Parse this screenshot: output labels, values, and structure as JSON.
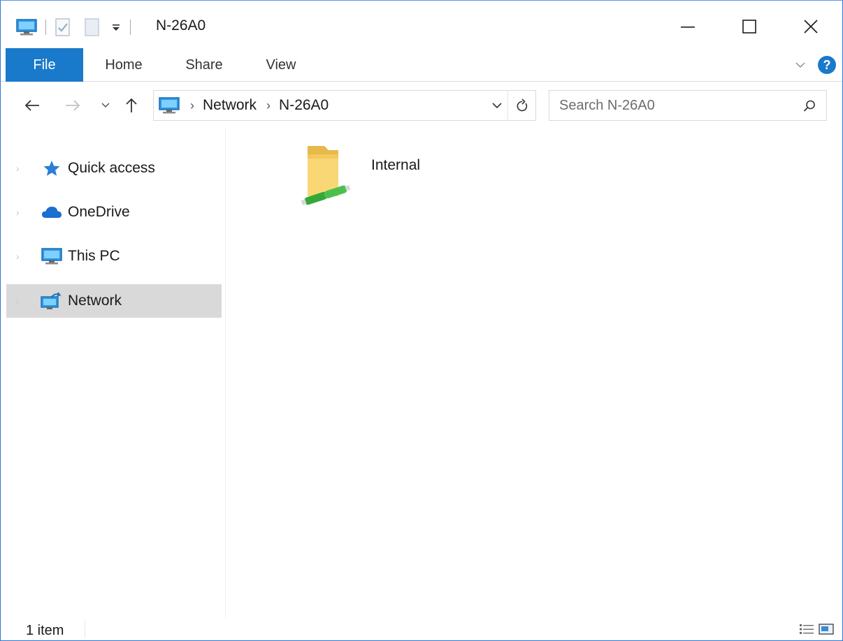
{
  "window": {
    "title": "N-26A0",
    "accent": "#1979ca"
  },
  "quick_access_toolbar": {
    "items": [
      "computer-icon",
      "properties-icon",
      "new-folder-icon",
      "customize-dropdown"
    ]
  },
  "ribbon": {
    "tabs": [
      {
        "label": "File",
        "active": true
      },
      {
        "label": "Home"
      },
      {
        "label": "Share"
      },
      {
        "label": "View"
      }
    ]
  },
  "address_bar": {
    "crumbs": [
      "Network",
      "N-26A0"
    ]
  },
  "search": {
    "placeholder": "Search N-26A0"
  },
  "nav_pane": {
    "items": [
      {
        "label": "Quick access",
        "icon": "star-icon"
      },
      {
        "label": "OneDrive",
        "icon": "cloud-icon"
      },
      {
        "label": "This PC",
        "icon": "computer-icon"
      },
      {
        "label": "Network",
        "icon": "network-icon",
        "selected": true
      }
    ]
  },
  "content": {
    "items": [
      {
        "name": "Internal",
        "type": "shared-folder"
      }
    ]
  },
  "status_bar": {
    "item_count": "1 item"
  }
}
